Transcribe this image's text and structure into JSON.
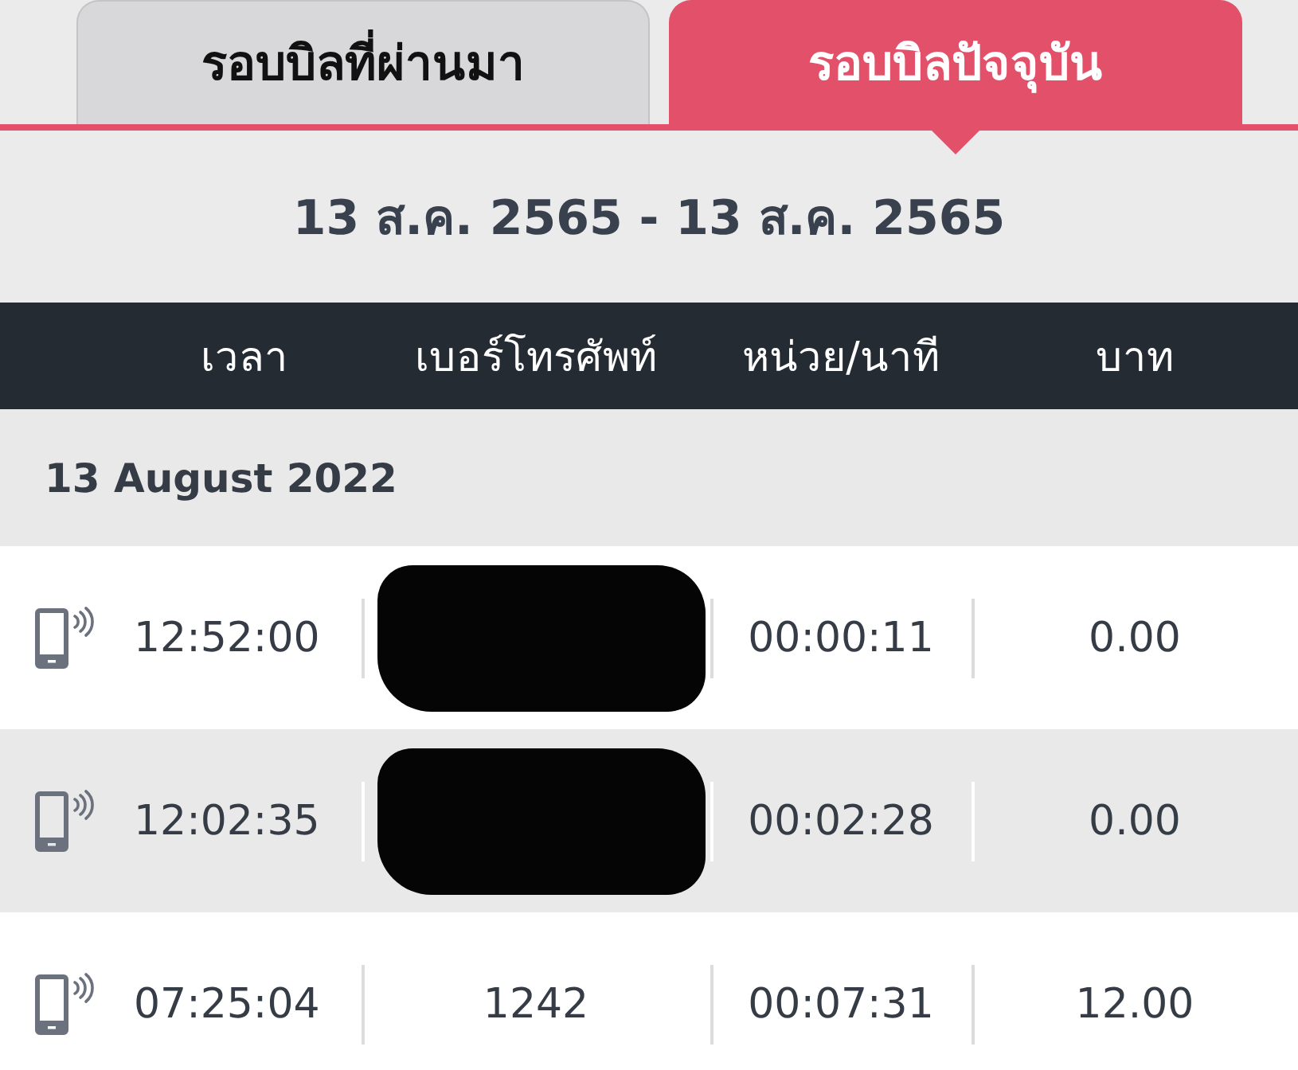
{
  "tabs": [
    {
      "label": "รอบบิลที่ผ่านมา",
      "selected": false
    },
    {
      "label": "รอบบิลปัจจุบัน",
      "selected": true
    }
  ],
  "period": "13 ส.ค. 2565 - 13 ส.ค. 2565",
  "table": {
    "columns": [
      "เวลา",
      "เบอร์โทรศัพท์",
      "หน่วย/นาที",
      "บาท"
    ],
    "groups": [
      {
        "date": "13 August 2022",
        "rows": [
          {
            "time": "12:52:00",
            "redacted": true,
            "units": "00:00:11",
            "baht": "0.00"
          },
          {
            "time": "12:02:35",
            "redacted": true,
            "units": "00:02:28",
            "baht": "0.00"
          },
          {
            "time": "07:25:04",
            "redacted": false,
            "phone": "1242",
            "units": "00:07:31",
            "baht": "12.00"
          }
        ]
      }
    ]
  }
}
